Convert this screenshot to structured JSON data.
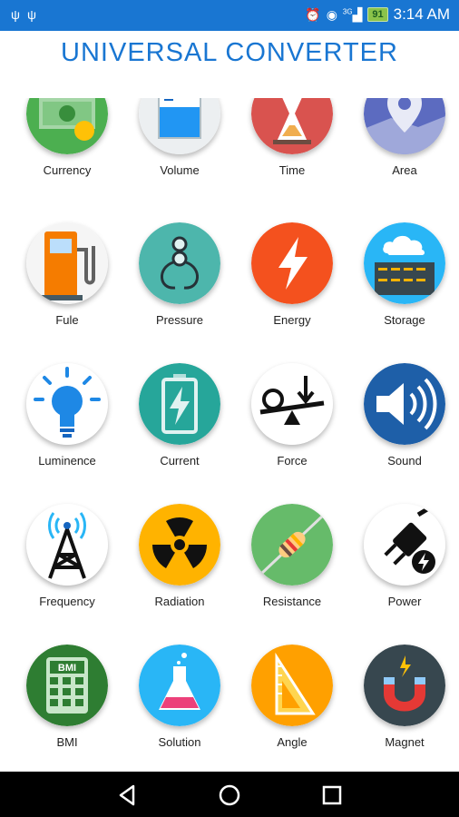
{
  "status_bar": {
    "time": "3:14 AM",
    "battery": "91",
    "network": "3G",
    "left_icons": [
      "usb-icon",
      "usb-icon"
    ],
    "right_icons": [
      "alarm-icon",
      "eye-icon",
      "signal-icon",
      "battery-icon"
    ]
  },
  "app": {
    "title": "UNIVERSAL CONVERTER",
    "title_color": "#1976d2"
  },
  "categories": [
    {
      "label": "Currency",
      "icon": "currency-icon"
    },
    {
      "label": "Volume",
      "icon": "volume-beaker-icon"
    },
    {
      "label": "Time",
      "icon": "hourglass-icon"
    },
    {
      "label": "Area",
      "icon": "map-pin-icon"
    },
    {
      "label": "Fule",
      "icon": "fuel-pump-icon"
    },
    {
      "label": "Pressure",
      "icon": "pressure-gauge-icon"
    },
    {
      "label": "Energy",
      "icon": "lightning-icon"
    },
    {
      "label": "Storage",
      "icon": "cloud-server-icon"
    },
    {
      "label": "Luminence",
      "icon": "light-bulb-icon"
    },
    {
      "label": "Current",
      "icon": "battery-charge-icon"
    },
    {
      "label": "Force",
      "icon": "lever-force-icon"
    },
    {
      "label": "Sound",
      "icon": "speaker-icon"
    },
    {
      "label": "Frequency",
      "icon": "radio-tower-icon"
    },
    {
      "label": "Radiation",
      "icon": "radiation-icon"
    },
    {
      "label": "Resistance",
      "icon": "resistor-icon"
    },
    {
      "label": "Power",
      "icon": "power-plug-icon"
    },
    {
      "label": "BMI",
      "icon": "bmi-calculator-icon"
    },
    {
      "label": "Solution",
      "icon": "flask-icon"
    },
    {
      "label": "Angle",
      "icon": "set-square-icon"
    },
    {
      "label": "Magnet",
      "icon": "magnet-icon"
    }
  ],
  "nav": [
    "back-icon",
    "home-icon",
    "recents-icon"
  ]
}
